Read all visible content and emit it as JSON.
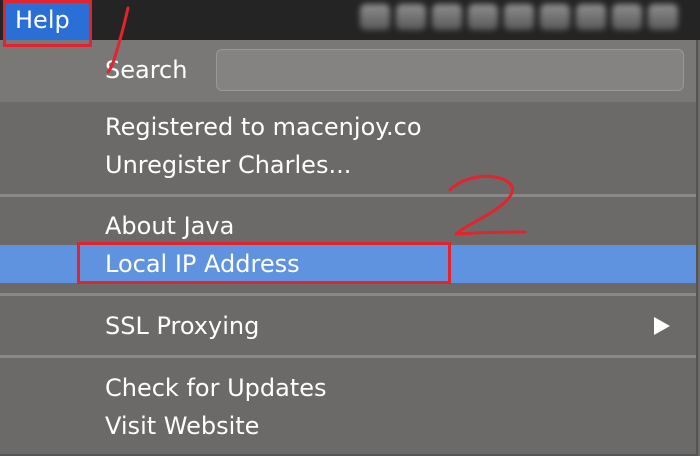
{
  "menubar": {
    "help_label": "Help"
  },
  "menu": {
    "search_label": "Search",
    "search_placeholder": "",
    "registered": "Registered to macenjoy.co",
    "unregister": "Unregister Charles...",
    "about_java": "About Java",
    "local_ip": "Local IP Address",
    "ssl_proxying": "SSL Proxying",
    "check_updates": "Check for Updates",
    "visit_website": "Visit Website"
  },
  "annotations": {
    "color": "#e3232e"
  },
  "colors": {
    "highlight": "#5f93e0",
    "menu_bg": "#6c6a69",
    "active_menu": "#2a6fd6"
  },
  "icons": {
    "submenu_arrow": "chevron-right-icon"
  }
}
